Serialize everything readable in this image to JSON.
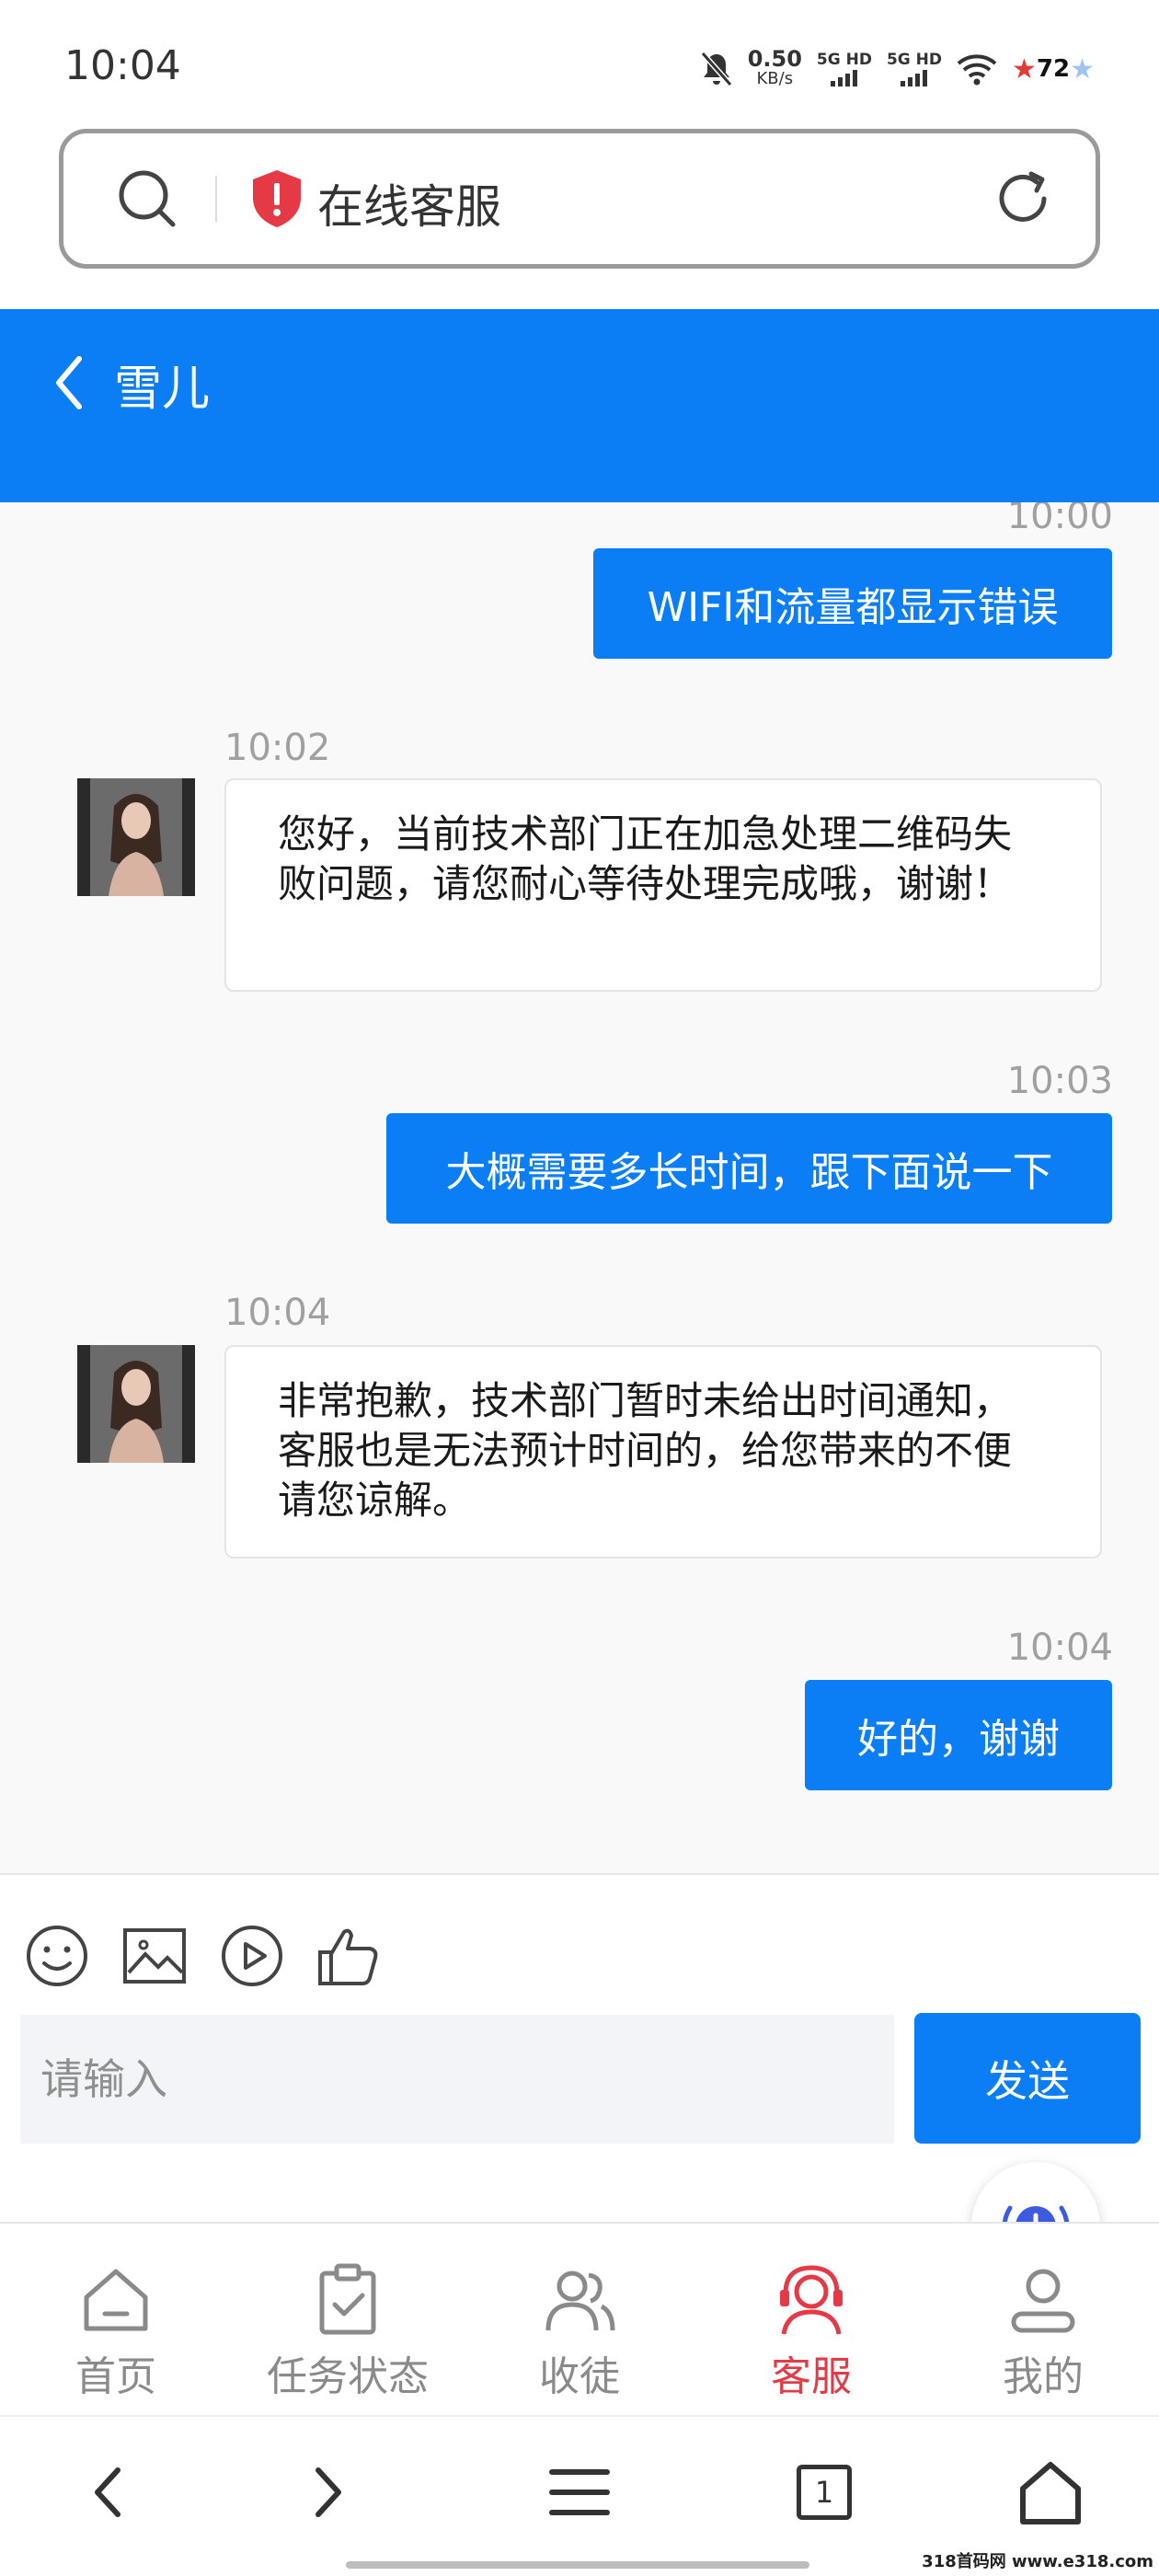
{
  "status_bar": {
    "time": "10:04",
    "speed_value": "0.50",
    "speed_unit": "KB/s",
    "sim1": "5G HD",
    "sim2": "5G HD",
    "battery": "72"
  },
  "browser": {
    "page_title": "在线客服"
  },
  "chat": {
    "contact_name": "雪儿",
    "messages": [
      {
        "direction": "out",
        "time": "10:00",
        "text": "WIFI和流量都显示错误"
      },
      {
        "direction": "in",
        "time": "10:02",
        "text": "您好，当前技术部门正在加急处理二维码失败问题，请您耐心等待处理完成哦，谢谢！"
      },
      {
        "direction": "out",
        "time": "10:03",
        "text": "大概需要多长时间，跟下面说一下"
      },
      {
        "direction": "in",
        "time": "10:04",
        "text": "非常抱歉，技术部门暂时未给出时间通知，客服也是无法预计时间的，给您带来的不便请您谅解。"
      },
      {
        "direction": "out",
        "time": "10:04",
        "text": "好的，谢谢"
      }
    ]
  },
  "composer": {
    "placeholder": "请输入",
    "send_label": "发送",
    "tools": [
      "emoji-icon",
      "image-icon",
      "video-icon",
      "thumbs-up-icon"
    ]
  },
  "bottom_nav": {
    "items": [
      {
        "label": "首页",
        "icon": "home-icon",
        "active": false
      },
      {
        "label": "任务状态",
        "icon": "clipboard-check-icon",
        "active": false
      },
      {
        "label": "收徒",
        "icon": "users-icon",
        "active": false
      },
      {
        "label": "客服",
        "icon": "headset-icon",
        "active": true
      },
      {
        "label": "我的",
        "icon": "profile-icon",
        "active": false
      }
    ]
  },
  "system_nav": {
    "tabs_count": "1"
  },
  "watermark": "318首码网 www.e318.com",
  "colors": {
    "primary": "#0b7ef5",
    "active_nav": "#e53946",
    "shield": "#e53946"
  }
}
